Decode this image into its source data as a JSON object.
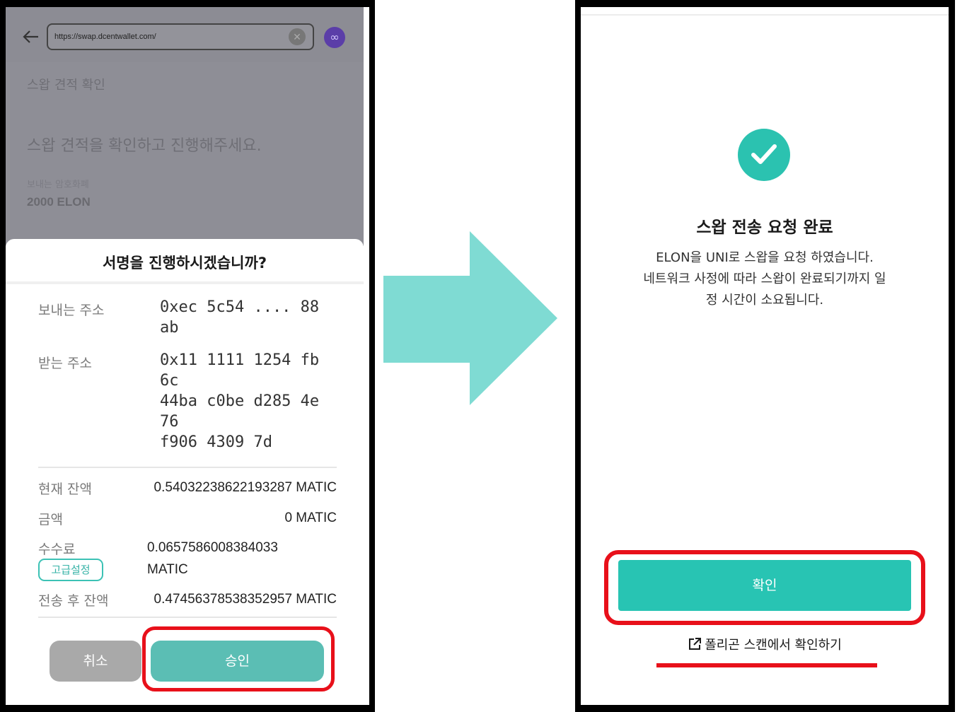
{
  "left_screen": {
    "browser": {
      "url": "https://swap.dcentwallet.com/",
      "back_icon": "arrow-left-icon",
      "clear_icon": "close-circle-icon",
      "network_icon": "polygon-icon"
    },
    "background_page": {
      "title": "스왑 견적 확인",
      "heading": "스왑 견적을 확인하고 진행해주세요.",
      "send_label": "보내는 암호화폐",
      "send_value": "2000 ELON"
    },
    "sign_sheet": {
      "title": "서명을 진행하시겠습니까?",
      "from_label": "보내는 주소",
      "from_lines": [
        "0xec 5c54 .... 88",
        "ab"
      ],
      "to_label": "받는 주소",
      "to_lines": [
        "0x11 1111 1254 fb",
        "6c",
        "44ba c0be d285 4e",
        "76",
        "f906 4309 7d"
      ],
      "balance_label": "현재 잔액",
      "balance_value": "0.54032238622193287 MATIC",
      "amount_label": "금액",
      "amount_value": "0 MATIC",
      "fee_label": "수수료",
      "fee_value_line1": "0.0657586008384033",
      "fee_value_line2": "MATIC",
      "advanced_button": "고급설정",
      "after_label": "전송 후 잔액",
      "after_value": "0.47456378538352957 MATIC",
      "cancel_button": "취소",
      "approve_button": "승인"
    }
  },
  "right_screen": {
    "success_icon": "check-circle-icon",
    "title": "스왑 전송 요청 완료",
    "message_lines": [
      "ELON을 UNI로 스왑을 요청 하였습니다.",
      "네트워크 사정에 따라 스왑이 완료되기까지 일",
      "정 시간이 소요됩니다."
    ],
    "confirm_button": "확인",
    "scan_link": "폴리곤 스캔에서 확인하기",
    "scan_link_icon": "external-link-icon"
  },
  "colors": {
    "accent": "#28c4b3",
    "approve": "#5bbeb4",
    "highlight": "#e8101a",
    "arrow": "#7fdbd3"
  }
}
